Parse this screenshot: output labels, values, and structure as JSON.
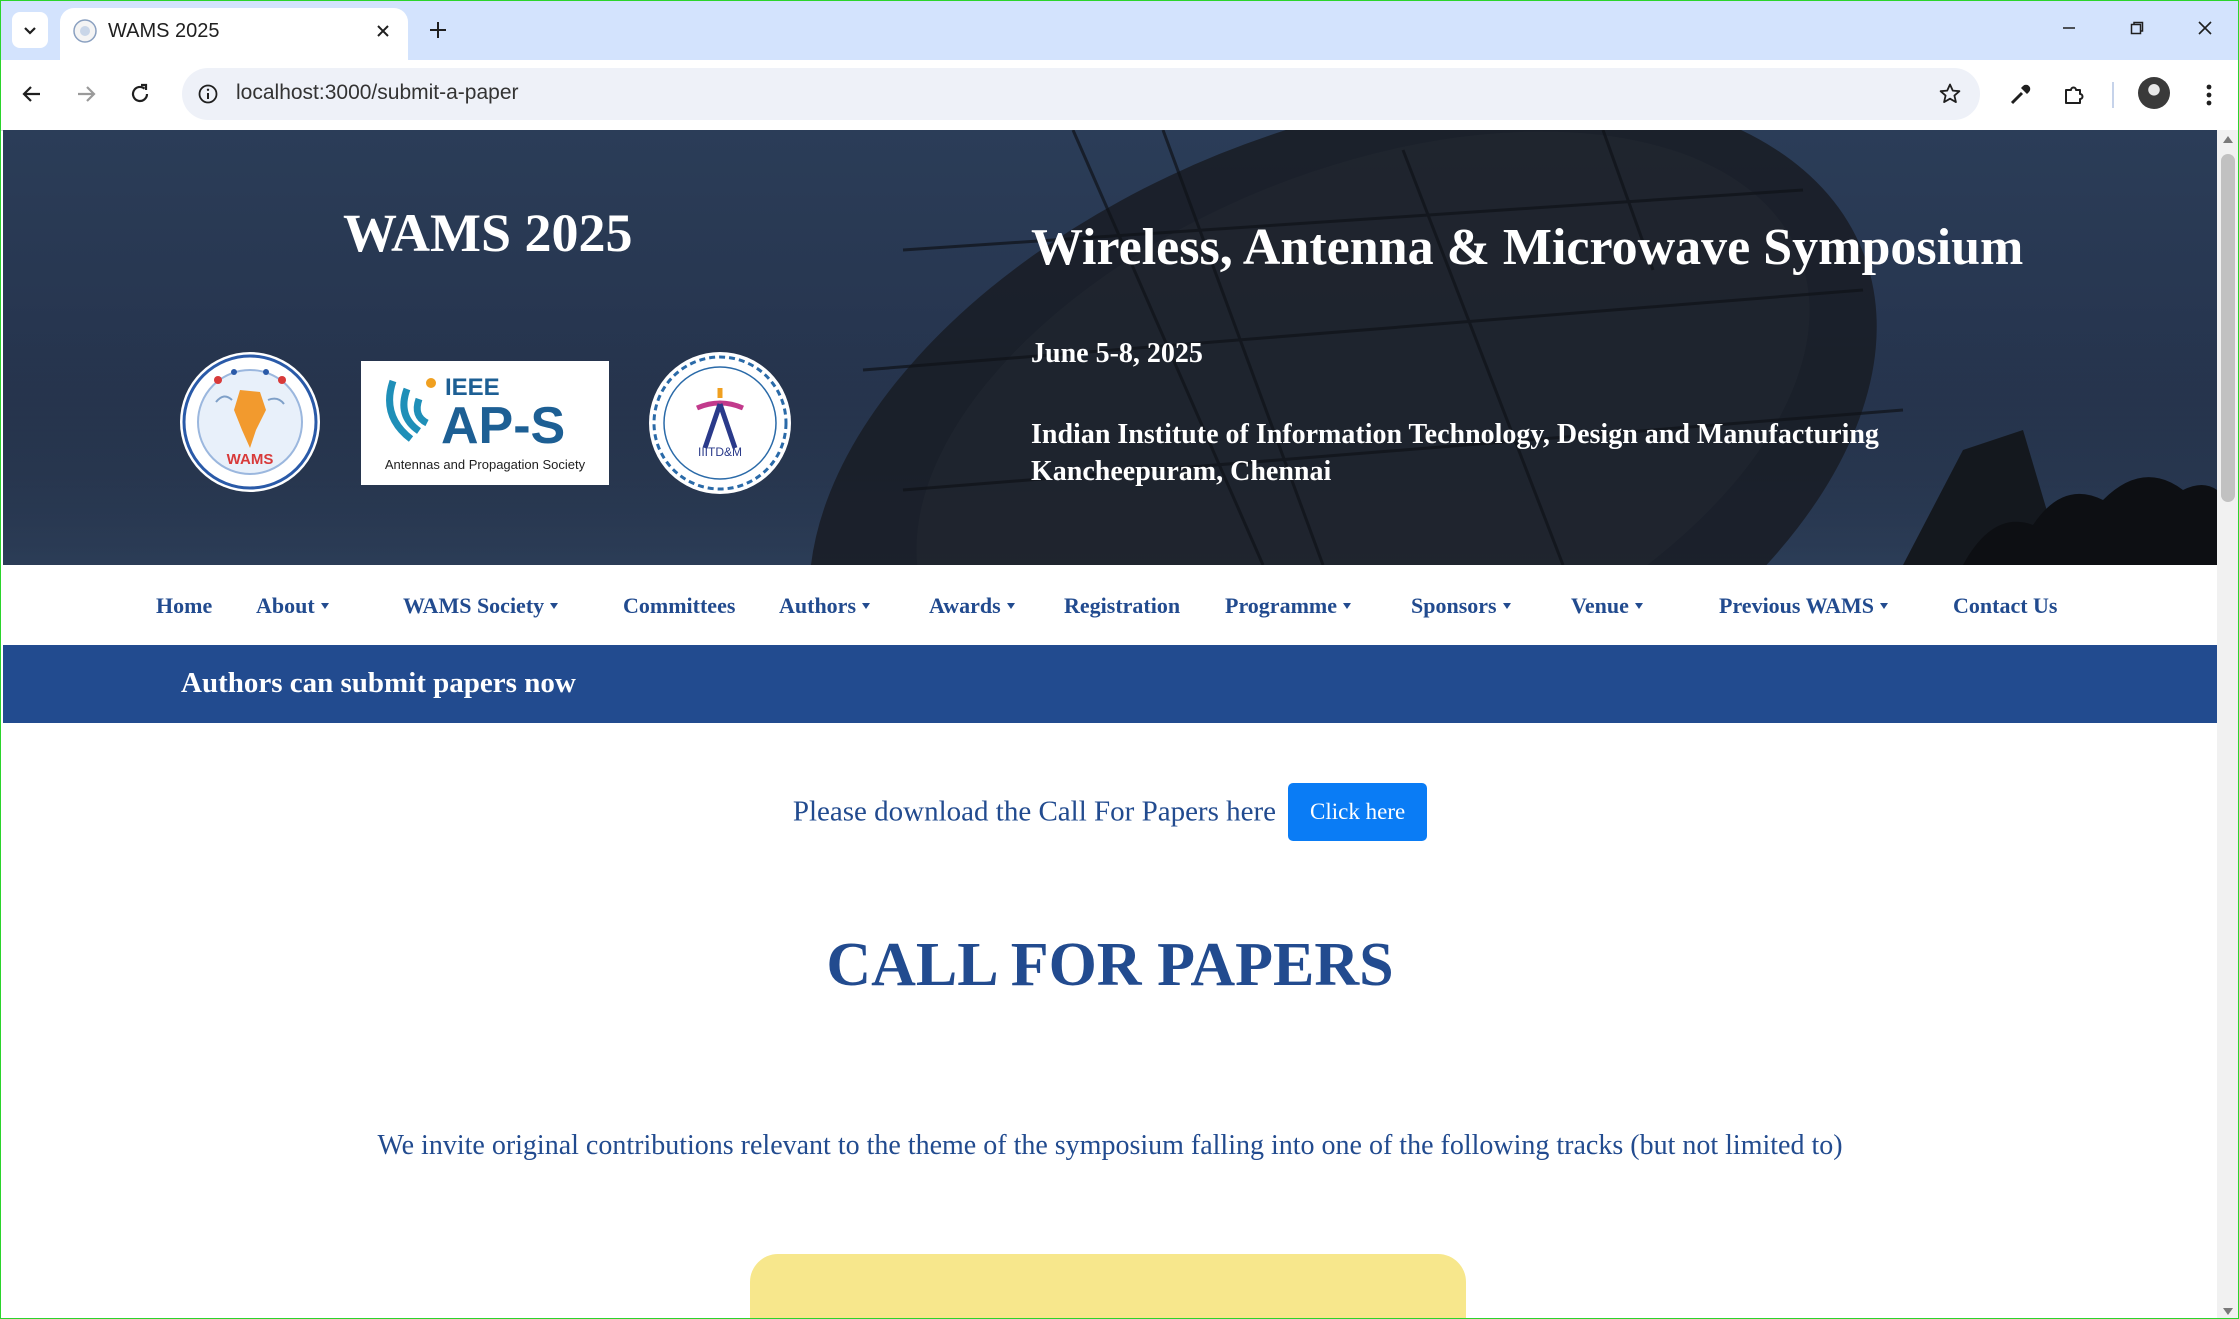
{
  "browser": {
    "tab_title": "WAMS 2025",
    "url": "localhost:3000/submit-a-paper"
  },
  "hero": {
    "short_title": "WAMS 2025",
    "logos": {
      "wams_text": "WAMS",
      "ieee_text": "IEEE",
      "aps_text": "AP-S",
      "aps_sub": "Antennas and Propagation Society",
      "iiit_text": "IIITD&M"
    },
    "symposium": "Wireless, Antenna & Microwave Symposium",
    "date": "June 5-8, 2025",
    "institute_line1": "Indian Institute of Information Technology, Design and Manufacturing",
    "institute_line2": "Kancheepuram, Chennai"
  },
  "nav": {
    "items": [
      {
        "label": "Home"
      },
      {
        "label": "About"
      },
      {
        "label": "WAMS Society"
      },
      {
        "label": "Committees"
      },
      {
        "label": "Authors"
      },
      {
        "label": "Awards"
      },
      {
        "label": "Registration"
      },
      {
        "label": "Programme"
      },
      {
        "label": "Sponsors"
      },
      {
        "label": "Venue"
      },
      {
        "label": "Previous WAMS"
      },
      {
        "label": "Contact Us"
      }
    ]
  },
  "banner": {
    "text": "Authors can submit papers now"
  },
  "content": {
    "download_text": "Please download the Call For Papers here",
    "download_button": "Click here",
    "heading": "CALL FOR PAPERS",
    "invite_text": "We invite original contributions relevant to the theme of the symposium falling into one of the following tracks (but not limited to)"
  },
  "colors": {
    "brand_blue": "#224b8f",
    "button_blue": "#0a7cf5",
    "track_yellow": "#f7e78c"
  }
}
